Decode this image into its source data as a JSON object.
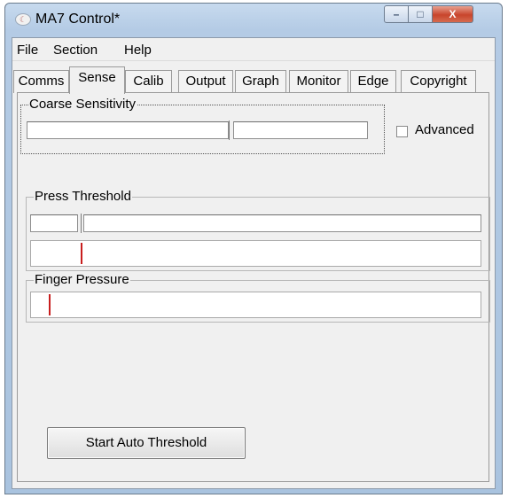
{
  "window": {
    "title": "MA7 Control*",
    "controls": {
      "minimize": "–",
      "maximize": "□",
      "close": "X"
    }
  },
  "menu": {
    "items": [
      "File",
      "Section",
      "Help"
    ]
  },
  "tabs": {
    "items": [
      "Comms",
      "Sense",
      "Calib",
      "Output",
      "Graph",
      "Monitor",
      "Edge",
      "Copyright"
    ],
    "active": "Sense"
  },
  "coarse_sensitivity": {
    "label": "Coarse Sensitivity",
    "slider_fraction": 0.57,
    "advanced_label": "Advanced",
    "advanced_checked": false
  },
  "press_threshold": {
    "label": "Press Threshold",
    "value": "",
    "slider_fraction": 0.0,
    "marker_fraction": 0.11
  },
  "finger_pressure": {
    "label": "Finger Pressure",
    "marker_fraction": 0.04
  },
  "auto_threshold": {
    "label": "Start Auto Threshold"
  },
  "colors": {
    "marker": "#c81e1e",
    "close_button": "#c8452c"
  }
}
